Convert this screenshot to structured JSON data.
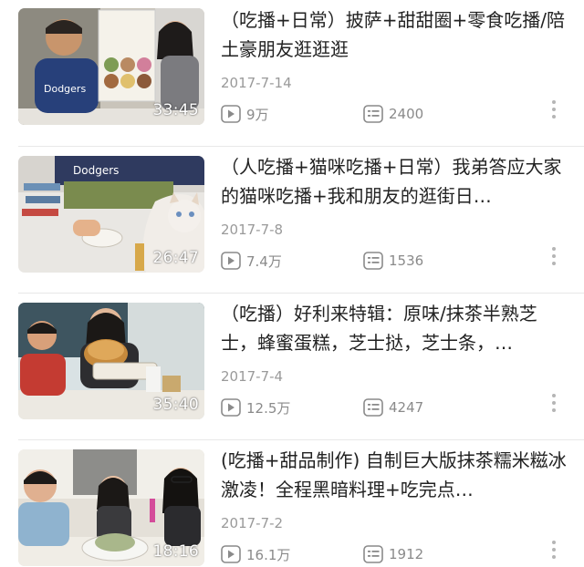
{
  "videos": [
    {
      "title": "（吃播+日常）披萨+甜甜圈+零食吃播/陪土豪朋友逛逛逛",
      "date": "2017-7-14",
      "duration": "33:45",
      "views": "9万",
      "comments": "2400"
    },
    {
      "title": "（人吃播+猫咪吃播+日常）我弟答应大家的猫咪吃播+我和朋友的逛街日…",
      "date": "2017-7-8",
      "duration": "26:47",
      "views": "7.4万",
      "comments": "1536"
    },
    {
      "title": "（吃播）好利来特辑：原味/抹茶半熟芝士，蜂蜜蛋糕，芝士挞，芝士条，…",
      "date": "2017-7-4",
      "duration": "35:40",
      "views": "12.5万",
      "comments": "4247"
    },
    {
      "title": "(吃播+甜品制作) 自制巨大版抹茶糯米糍冰激凌！全程黑暗料理+吃完点…",
      "date": "2017-7-2",
      "duration": "18:16",
      "views": "16.1万",
      "comments": "1912"
    }
  ],
  "icons": {
    "play": "play-icon",
    "comment": "comment-icon",
    "more": "more-vertical-icon"
  },
  "colors": {
    "title": "#222222",
    "meta": "#9a9a9a",
    "icon": "#8a8a8a",
    "separator": "#e8e8e8"
  }
}
